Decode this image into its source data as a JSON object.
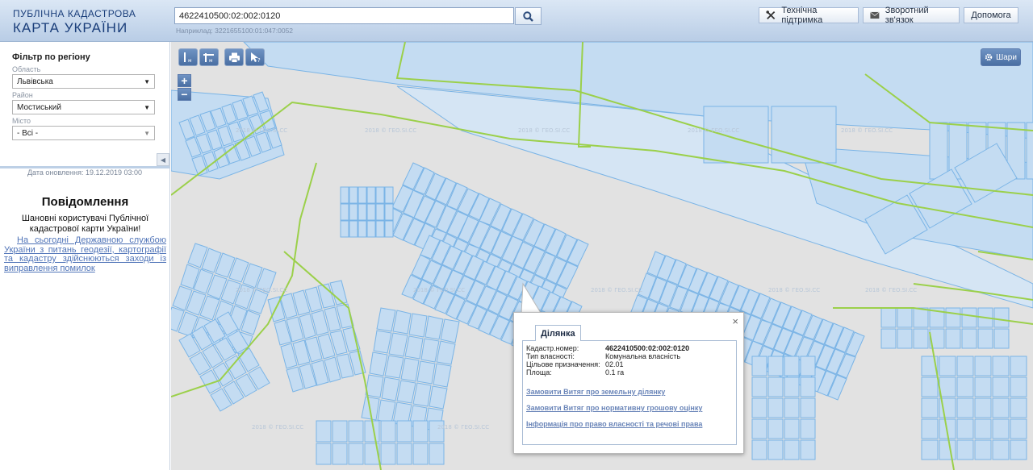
{
  "header": {
    "logo_line1": "ПУБЛІЧНА КАДАСТРОВА",
    "logo_line2": "КАРТА УКРАЇНИ",
    "search_value": "4622410500:02:002:0120",
    "search_hint": "Наприклад: 3221655100:01:047:0052",
    "support_label": "Технічна підтримка",
    "feedback_label": "Зворотний зв'язок",
    "help_label": "Допомога"
  },
  "sidebar": {
    "filter_title": "Фільтр по регіону",
    "oblast_label": "Область",
    "oblast_value": "Львівська",
    "rayon_label": "Район",
    "rayon_value": "Мостиський",
    "city_label": "Місто",
    "city_value": "- Всі -",
    "update_date": "Дата оновлення: 19.12.2019 03:00",
    "notice_title": "Повідомлення",
    "notice_text": "Шановні користувачі Публічної кадастрової карти України!",
    "notice_link": "На сьогодні Державною службою України з питань геодезії, картографії та кадастру здійснюються заходи із виправлення помилок"
  },
  "map": {
    "layers_label": "Шари",
    "zoom_in": "+",
    "zoom_out": "−",
    "watermark": "2018 © ГЕО.SI.CC"
  },
  "popup": {
    "tab_label": "Ділянка",
    "close": "×",
    "rows": [
      {
        "k": "Кадастр.номер:",
        "v": "4622410500:02:002:0120"
      },
      {
        "k": "Тип власності:",
        "v": "Комунальна власність"
      },
      {
        "k": "Цільове призначення:",
        "v": "02.01"
      },
      {
        "k": "Площа:",
        "v": "0.1 га"
      }
    ],
    "link1": "Замовити Витяг про земельну ділянку",
    "link2": "Замовити Витяг про нормативну грошову оцінку",
    "link3": "Інформація про право власності та речові права"
  },
  "colors": {
    "parcel_fill": "#c4dcf2",
    "parcel_stroke": "#7ab4e6",
    "boundary": "#9bd04a",
    "accent": "#4a6fa3"
  }
}
